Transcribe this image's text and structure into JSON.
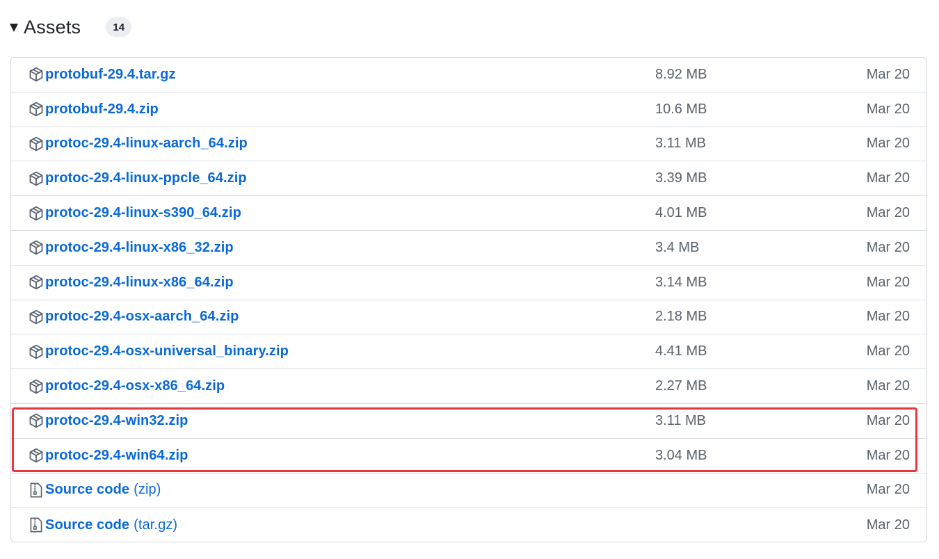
{
  "header": {
    "title": "Assets",
    "count": "14"
  },
  "assets": [
    {
      "name": "protobuf-29.4.tar.gz",
      "size": "8.92 MB",
      "date": "Mar 20",
      "icon": "package-icon"
    },
    {
      "name": "protobuf-29.4.zip",
      "size": "10.6 MB",
      "date": "Mar 20",
      "icon": "package-icon"
    },
    {
      "name": "protoc-29.4-linux-aarch_64.zip",
      "size": "3.11 MB",
      "date": "Mar 20",
      "icon": "package-icon"
    },
    {
      "name": "protoc-29.4-linux-ppcle_64.zip",
      "size": "3.39 MB",
      "date": "Mar 20",
      "icon": "package-icon"
    },
    {
      "name": "protoc-29.4-linux-s390_64.zip",
      "size": "4.01 MB",
      "date": "Mar 20",
      "icon": "package-icon"
    },
    {
      "name": "protoc-29.4-linux-x86_32.zip",
      "size": "3.4 MB",
      "date": "Mar 20",
      "icon": "package-icon"
    },
    {
      "name": "protoc-29.4-linux-x86_64.zip",
      "size": "3.14 MB",
      "date": "Mar 20",
      "icon": "package-icon"
    },
    {
      "name": "protoc-29.4-osx-aarch_64.zip",
      "size": "2.18 MB",
      "date": "Mar 20",
      "icon": "package-icon"
    },
    {
      "name": "protoc-29.4-osx-universal_binary.zip",
      "size": "4.41 MB",
      "date": "Mar 20",
      "icon": "package-icon"
    },
    {
      "name": "protoc-29.4-osx-x86_64.zip",
      "size": "2.27 MB",
      "date": "Mar 20",
      "icon": "package-icon"
    },
    {
      "name": "protoc-29.4-win32.zip",
      "size": "3.11 MB",
      "date": "Mar 20",
      "icon": "package-icon"
    },
    {
      "name": "protoc-29.4-win64.zip",
      "size": "3.04 MB",
      "date": "Mar 20",
      "icon": "package-icon"
    }
  ],
  "source": [
    {
      "label": "Source code",
      "suffix": "(zip)",
      "date": "Mar 20",
      "icon": "file-zip-icon"
    },
    {
      "label": "Source code",
      "suffix": "(tar.gz)",
      "date": "Mar 20",
      "icon": "file-zip-icon"
    }
  ],
  "colors": {
    "link": "#0969da",
    "muted": "#59636e",
    "highlight": "#ee3340",
    "border": "#d0d7de"
  }
}
